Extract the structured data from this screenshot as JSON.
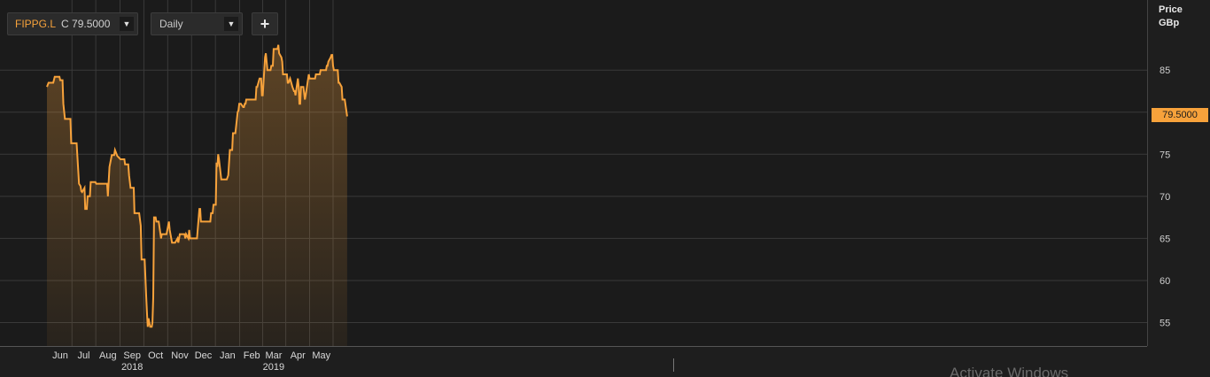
{
  "toolbar": {
    "ticker_symbol": "FIPPG.L",
    "ticker_price": "C 79.5000",
    "interval": "Daily",
    "dropdown_glyph": "▼",
    "add_glyph": "+"
  },
  "price_axis": {
    "title_line1": "Price",
    "title_line2": "GBp"
  },
  "last_price_label": "79.5000",
  "watermark": "Activate Windows",
  "colors": {
    "line": "#f7a23b",
    "background": "#1e1e1e",
    "grid": "#3a3a3a"
  },
  "chart_data": {
    "type": "area",
    "x_axis_type": "date",
    "y_axis_side": "right",
    "ylabel": "Price GBp",
    "ylim": [
      53,
      93
    ],
    "yticks": [
      55,
      60,
      65,
      70,
      75,
      80,
      85
    ],
    "month_ticks": [
      {
        "date": "2018-06-01",
        "label": "Jun"
      },
      {
        "date": "2018-07-01",
        "label": "Jul"
      },
      {
        "date": "2018-08-01",
        "label": "Aug"
      },
      {
        "date": "2018-09-01",
        "label": "Sep"
      },
      {
        "date": "2018-10-01",
        "label": "Oct"
      },
      {
        "date": "2018-11-01",
        "label": "Nov"
      },
      {
        "date": "2018-12-01",
        "label": "Dec"
      },
      {
        "date": "2019-01-01",
        "label": "Jan"
      },
      {
        "date": "2019-02-01",
        "label": "Feb"
      },
      {
        "date": "2019-03-01",
        "label": "Mar"
      },
      {
        "date": "2019-04-01",
        "label": "Apr"
      },
      {
        "date": "2019-05-01",
        "label": "May"
      }
    ],
    "year_labels": [
      {
        "date": "2018-09-01",
        "label": "2018"
      },
      {
        "date": "2019-03-01",
        "label": "2019"
      }
    ],
    "last_value": 79.5,
    "series": [
      {
        "name": "FIPPG.L",
        "points": [
          [
            "2018-05-15",
            83.0
          ],
          [
            "2018-05-17",
            83.5
          ],
          [
            "2018-05-23",
            83.5
          ],
          [
            "2018-05-25",
            84.2
          ],
          [
            "2018-05-31",
            84.2
          ],
          [
            "2018-06-01",
            83.8
          ],
          [
            "2018-06-04",
            83.8
          ],
          [
            "2018-06-05",
            81.0
          ],
          [
            "2018-06-07",
            79.2
          ],
          [
            "2018-06-14",
            79.2
          ],
          [
            "2018-06-15",
            76.3
          ],
          [
            "2018-06-22",
            76.3
          ],
          [
            "2018-06-25",
            71.5
          ],
          [
            "2018-06-27",
            71.2
          ],
          [
            "2018-06-28",
            70.6
          ],
          [
            "2018-06-29",
            70.5
          ],
          [
            "2018-07-02",
            71.0
          ],
          [
            "2018-07-03",
            68.5
          ],
          [
            "2018-07-05",
            68.5
          ],
          [
            "2018-07-06",
            70.0
          ],
          [
            "2018-07-09",
            70.0
          ],
          [
            "2018-07-10",
            71.7
          ],
          [
            "2018-07-16",
            71.7
          ],
          [
            "2018-07-17",
            71.5
          ],
          [
            "2018-07-31",
            71.5
          ],
          [
            "2018-08-01",
            70.0
          ],
          [
            "2018-08-03",
            73.5
          ],
          [
            "2018-08-06",
            74.9
          ],
          [
            "2018-08-09",
            74.9
          ],
          [
            "2018-08-10",
            75.5
          ],
          [
            "2018-08-13",
            74.8
          ],
          [
            "2018-08-15",
            74.6
          ],
          [
            "2018-08-17",
            74.4
          ],
          [
            "2018-08-22",
            74.4
          ],
          [
            "2018-08-23",
            73.8
          ],
          [
            "2018-08-27",
            73.8
          ],
          [
            "2018-08-28",
            72.5
          ],
          [
            "2018-08-30",
            71.0
          ],
          [
            "2018-09-03",
            71.0
          ],
          [
            "2018-09-04",
            68.0
          ],
          [
            "2018-09-10",
            68.0
          ],
          [
            "2018-09-12",
            66.5
          ],
          [
            "2018-09-13",
            62.5
          ],
          [
            "2018-09-17",
            62.5
          ],
          [
            "2018-09-19",
            58.0
          ],
          [
            "2018-09-20",
            56.0
          ],
          [
            "2018-09-21",
            54.5
          ],
          [
            "2018-09-22",
            55.5
          ],
          [
            "2018-09-24",
            54.5
          ],
          [
            "2018-09-26",
            54.5
          ],
          [
            "2018-09-27",
            55.0
          ],
          [
            "2018-09-28",
            58.0
          ],
          [
            "2018-09-29",
            67.5
          ],
          [
            "2018-10-01",
            67.5
          ],
          [
            "2018-10-02",
            67.0
          ],
          [
            "2018-10-05",
            67.0
          ],
          [
            "2018-10-08",
            65.0
          ],
          [
            "2018-10-09",
            65.5
          ],
          [
            "2018-10-15",
            65.5
          ],
          [
            "2018-10-18",
            67.0
          ],
          [
            "2018-10-19",
            66.0
          ],
          [
            "2018-10-22",
            64.5
          ],
          [
            "2018-10-26",
            64.5
          ],
          [
            "2018-10-29",
            65.0
          ],
          [
            "2018-10-30",
            64.5
          ],
          [
            "2018-11-01",
            65.5
          ],
          [
            "2018-11-07",
            65.5
          ],
          [
            "2018-11-08",
            65.0
          ],
          [
            "2018-11-09",
            65.5
          ],
          [
            "2018-11-12",
            65.0
          ],
          [
            "2018-11-13",
            66.0
          ],
          [
            "2018-11-14",
            65.0
          ],
          [
            "2018-11-23",
            65.0
          ],
          [
            "2018-11-26",
            68.5
          ],
          [
            "2018-11-27",
            68.5
          ],
          [
            "2018-11-28",
            67.0
          ],
          [
            "2018-12-10",
            67.0
          ],
          [
            "2018-12-11",
            68.0
          ],
          [
            "2018-12-13",
            68.0
          ],
          [
            "2018-12-14",
            69.0
          ],
          [
            "2018-12-17",
            69.0
          ],
          [
            "2018-12-18",
            74.0
          ],
          [
            "2018-12-19",
            73.5
          ],
          [
            "2018-12-20",
            75.0
          ],
          [
            "2018-12-21",
            74.5
          ],
          [
            "2018-12-24",
            72.0
          ],
          [
            "2018-12-31",
            72.0
          ],
          [
            "2019-01-02",
            72.5
          ],
          [
            "2019-01-04",
            75.5
          ],
          [
            "2019-01-07",
            75.5
          ],
          [
            "2019-01-08",
            77.5
          ],
          [
            "2019-01-11",
            77.5
          ],
          [
            "2019-01-14",
            80.0
          ],
          [
            "2019-01-15",
            80.2
          ],
          [
            "2019-01-16",
            81.0
          ],
          [
            "2019-01-18",
            81.0
          ],
          [
            "2019-01-21",
            80.6
          ],
          [
            "2019-01-22",
            80.6
          ],
          [
            "2019-01-23",
            81.0
          ],
          [
            "2019-01-24",
            81.0
          ],
          [
            "2019-01-25",
            81.5
          ],
          [
            "2019-02-06",
            81.5
          ],
          [
            "2019-02-07",
            83.0
          ],
          [
            "2019-02-08",
            83.0
          ],
          [
            "2019-02-11",
            84.0
          ],
          [
            "2019-02-13",
            84.0
          ],
          [
            "2019-02-14",
            82.0
          ],
          [
            "2019-02-15",
            82.0
          ],
          [
            "2019-02-18",
            86.5
          ],
          [
            "2019-02-19",
            87.0
          ],
          [
            "2019-02-21",
            85.0
          ],
          [
            "2019-02-25",
            85.0
          ],
          [
            "2019-02-26",
            85.5
          ],
          [
            "2019-02-28",
            85.5
          ],
          [
            "2019-03-01",
            87.5
          ],
          [
            "2019-03-06",
            87.5
          ],
          [
            "2019-03-07",
            88.0
          ],
          [
            "2019-03-08",
            87.0
          ],
          [
            "2019-03-11",
            86.5
          ],
          [
            "2019-03-12",
            86.0
          ],
          [
            "2019-03-13",
            84.5
          ],
          [
            "2019-03-18",
            84.5
          ],
          [
            "2019-03-19",
            83.5
          ],
          [
            "2019-03-20",
            83.5
          ],
          [
            "2019-03-22",
            84.0
          ],
          [
            "2019-03-25",
            83.0
          ],
          [
            "2019-03-27",
            82.5
          ],
          [
            "2019-03-28",
            82.5
          ],
          [
            "2019-03-29",
            82.0
          ],
          [
            "2019-04-01",
            84.0
          ],
          [
            "2019-04-02",
            83.0
          ],
          [
            "2019-04-03",
            81.0
          ],
          [
            "2019-04-04",
            81.0
          ],
          [
            "2019-04-05",
            83.0
          ],
          [
            "2019-04-08",
            83.0
          ],
          [
            "2019-04-10",
            81.5
          ],
          [
            "2019-04-11",
            82.0
          ],
          [
            "2019-04-15",
            84.5
          ],
          [
            "2019-04-16",
            84.0
          ],
          [
            "2019-04-23",
            84.0
          ],
          [
            "2019-04-24",
            84.5
          ],
          [
            "2019-04-29",
            84.5
          ],
          [
            "2019-04-30",
            85.0
          ],
          [
            "2019-05-07",
            85.0
          ],
          [
            "2019-05-08",
            85.5
          ],
          [
            "2019-05-09",
            85.5
          ],
          [
            "2019-05-10",
            86.0
          ],
          [
            "2019-05-13",
            86.5
          ],
          [
            "2019-05-14",
            86.8
          ],
          [
            "2019-05-15",
            86.8
          ],
          [
            "2019-05-16",
            85.5
          ],
          [
            "2019-05-17",
            85.0
          ],
          [
            "2019-05-22",
            85.0
          ],
          [
            "2019-05-23",
            83.5
          ],
          [
            "2019-05-24",
            83.5
          ],
          [
            "2019-05-27",
            83.0
          ],
          [
            "2019-05-28",
            81.5
          ],
          [
            "2019-05-31",
            81.5
          ],
          [
            "2019-06-03",
            79.5
          ]
        ]
      }
    ]
  }
}
